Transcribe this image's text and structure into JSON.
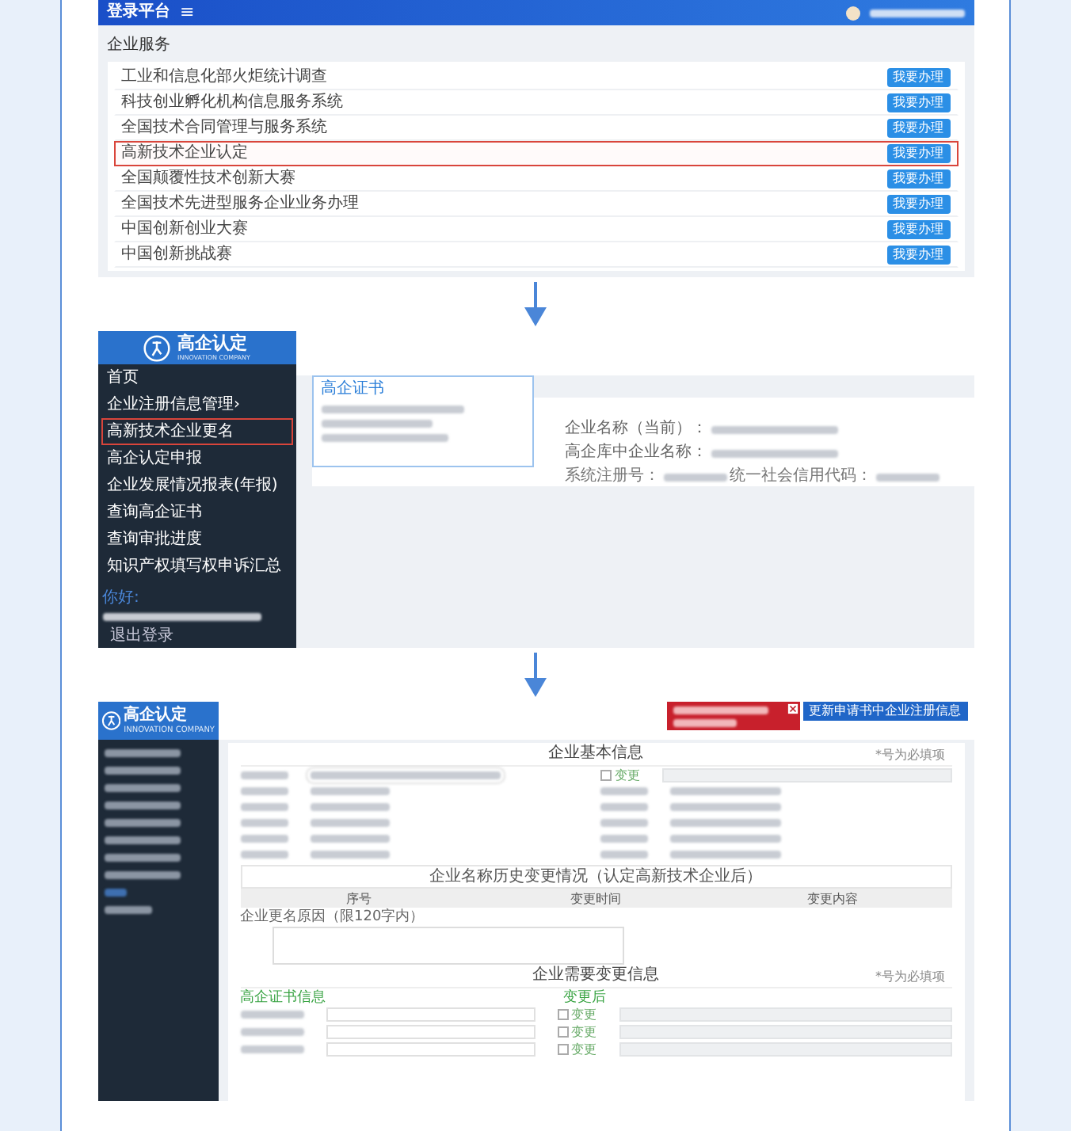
{
  "portal": {
    "title": "登录平台",
    "menu_glyph": "≡",
    "section": "企业服务",
    "services": [
      {
        "name": "工业和信息化部火炬统计调查",
        "button": "我要办理",
        "selected": false
      },
      {
        "name": "科技创业孵化机构信息服务系统",
        "button": "我要办理",
        "selected": false
      },
      {
        "name": "全国技术合同管理与服务系统",
        "button": "我要办理",
        "selected": false
      },
      {
        "name": "高新技术企业认定",
        "button": "我要办理",
        "selected": true
      },
      {
        "name": "全国颠覆性技术创新大赛",
        "button": "我要办理",
        "selected": false
      },
      {
        "name": "全国技术先进型服务企业业务办理",
        "button": "我要办理",
        "selected": false
      },
      {
        "name": "中国创新创业大赛",
        "button": "我要办理",
        "selected": false
      },
      {
        "name": "中国创新挑战赛",
        "button": "我要办理",
        "selected": false
      }
    ]
  },
  "rename_page": {
    "logo": "高企认定",
    "logo_sub": "INNOVATION COMPANY",
    "menu": [
      {
        "label": "首页",
        "selected": false
      },
      {
        "label": "企业注册信息管理",
        "arrow": "›",
        "selected": false
      },
      {
        "label": "高新技术企业更名",
        "selected": true
      },
      {
        "label": "高企认定申报",
        "selected": false
      },
      {
        "label": "企业发展情况报表(年报)",
        "selected": false
      },
      {
        "label": "查询高企证书",
        "selected": false
      },
      {
        "label": "查询审批进度",
        "selected": false
      },
      {
        "label": "知识产权填写权申诉汇总",
        "selected": false
      }
    ],
    "greeting": "你好:",
    "logout": "退出登录",
    "card_title": "高企证书",
    "fields": [
      "企业名称（当前）：",
      "高企库中企业名称："
    ],
    "small_fields": [
      "系统注册号：",
      "统一社会信用代码："
    ]
  },
  "form_page": {
    "logo": "高企认定",
    "logo_sub": "INNOVATION COMPANY",
    "update_button": "更新申请书中企业注册信息",
    "basic_title": "企业基本信息",
    "required_note": "*号为必填项",
    "basic_checkbox": {
      "label": "变更",
      "checked": false
    },
    "change_table_title": "企业名称历史变更情况（认定高新技术企业后）",
    "table_headers": [
      "序号",
      "变更时间",
      "变更内容"
    ],
    "reason_label": "企业更名原因（限120字内）",
    "change_title": "企业需要变更信息",
    "change_note": "*号为必填项",
    "cert_section": "高企证书信息",
    "after_label": "变更后",
    "change_checkboxes": [
      {
        "label": "变更",
        "checked": false
      },
      {
        "label": "变更",
        "checked": false
      },
      {
        "label": "变更",
        "checked": false
      }
    ]
  }
}
